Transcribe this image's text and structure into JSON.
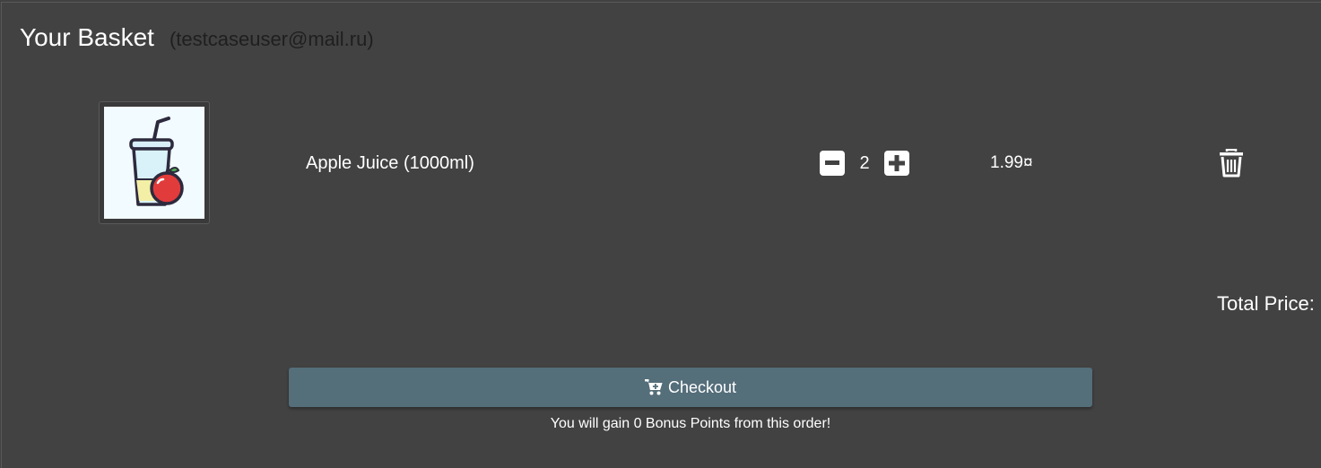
{
  "basket": {
    "title": "Your Basket",
    "user_email": "(testcaseuser@mail.ru)"
  },
  "items": [
    {
      "name": "Apple Juice (1000ml)",
      "quantity": "2",
      "price": "1.99¤",
      "image_icon": "apple-juice-image"
    }
  ],
  "summary": {
    "total_label": "Total Price:"
  },
  "checkout": {
    "label": "Checkout",
    "icon": "cart-plus-icon",
    "bonus_text": "You will gain 0 Bonus Points from this order!"
  },
  "colors": {
    "background": "#424242",
    "checkout_button": "#546e7a"
  }
}
